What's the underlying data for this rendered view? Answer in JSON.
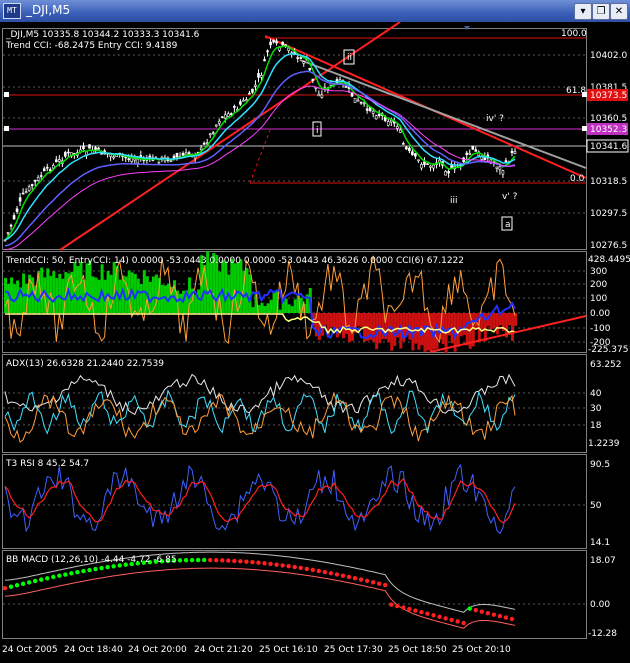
{
  "window": {
    "title": "_DJI,M5",
    "app_icon": "metatrader-chart-icon",
    "buttons": [
      "minimize-icon",
      "restore-icon",
      "close-icon"
    ]
  },
  "main": {
    "legend": "_DJI,M5  10335.8 10344.2 10333.3 10341.6",
    "sublegend": "Trend CCI: -68.2475 Entry CCI: 9.4189",
    "prices": [
      "10402.0",
      "10381.5",
      "10360.5",
      "10341.6",
      "10318.5",
      "10297.5",
      "10276.5"
    ],
    "fib_100": "100.0",
    "fib_618": "61.8",
    "fib_0": "0.0",
    "red_tag": "10373.5",
    "magenta_tag": "10352.3",
    "current_tag": "10341.6",
    "wave_labels": {
      "i": "i",
      "ii": "ii",
      "iii": "iii",
      "iv": "iv' ?",
      "v": "v' ?",
      "a": "a"
    }
  },
  "cci_panel": {
    "legend": "TrendCCI: 50, EntryCCI: 14)  0.0000 -53.0443 0.0000 0.0000 -53.0443 46.3626 0.0000  CCI(6) 67.1222",
    "scale": [
      "428.4495",
      "300",
      "200",
      "100",
      "0.00",
      "-100",
      "-200",
      "-225.375"
    ]
  },
  "adx_panel": {
    "legend": "ADX(13) 26.6328 21.2440 22.7539",
    "scale": [
      "63.252",
      "40",
      "30",
      "18",
      "1.2239"
    ]
  },
  "rsi_panel": {
    "legend": "T3 RSI 8 45.2 54.7",
    "scale": [
      "90.5",
      "50",
      "14.1"
    ]
  },
  "macd_panel": {
    "legend": "BB MACD (12,26,10) -4.44 -4.72 -6.85",
    "scale": [
      "18.07",
      "0.00",
      "-12.28"
    ]
  },
  "time_axis": [
    "24 Oct 2005",
    "24 Oct 18:40",
    "24 Oct 20:00",
    "24 Oct 21:20",
    "25 Oct 16:10",
    "25 Oct 17:30",
    "25 Oct 18:50",
    "25 Oct 20:10"
  ],
  "colors": {
    "candles": "#ffffff",
    "ma_green": "#00e000",
    "ma_cyan": "#30e0ff",
    "ma_blue": "#6060ff",
    "ma_magenta": "#ff40ff",
    "trend_red": "#ff2020",
    "channel_gray": "#a0a0a0",
    "cci_green": "#00cc00",
    "cci_red": "#cc1010",
    "cci_orange": "#ff9e3d",
    "cci_blue": "#2030ff",
    "adx_white": "#e8e8e8",
    "adx_cyan": "#40e0ff",
    "adx_orange": "#ff9e3d",
    "rsi_blue": "#4060ff",
    "rsi_red": "#ff2020",
    "macd_green": "#00ff00",
    "macd_red": "#ff2020"
  }
}
